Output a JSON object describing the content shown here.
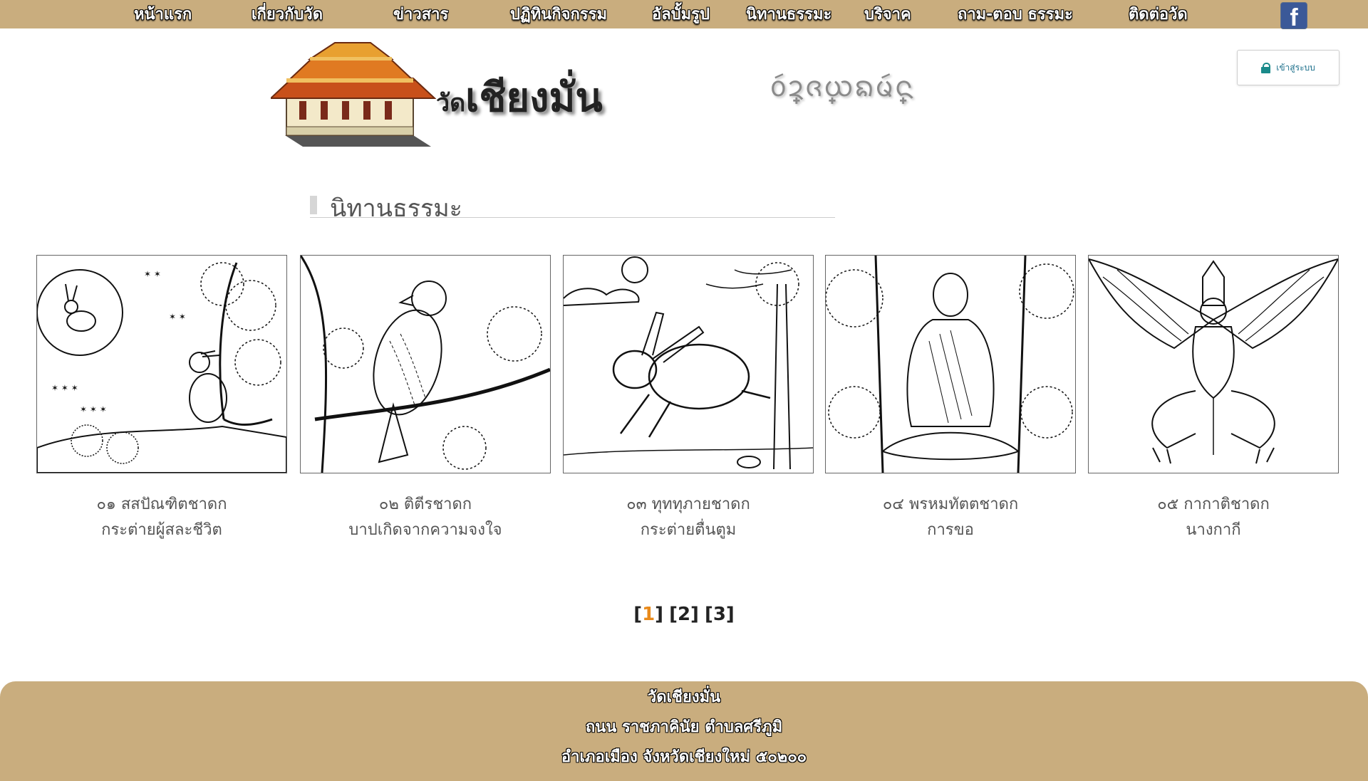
{
  "nav": {
    "items": [
      {
        "label": "หน้าแรก"
      },
      {
        "label": "เกี่ยวกับวัด"
      },
      {
        "label": "ข่าวสาร"
      },
      {
        "label": "ปฏิทินกิจกรรม"
      },
      {
        "label": "อัลบั้มรูป"
      },
      {
        "label": "นิทานธรรมะ"
      },
      {
        "label": "บริจาค"
      },
      {
        "label": "ถาม-ตอบ ธรรมะ"
      },
      {
        "label": "ติดต่อวัด"
      }
    ],
    "facebook_icon": "facebook-icon",
    "facebook_glyph": "f"
  },
  "header": {
    "brand_prefix": "วัด",
    "brand_name": "เชียงมั่น",
    "lanna_script": "ᩅᩢ᩠ᨯᨩ᩠ᨿᨦᨾᩢ᩠ᨶ",
    "login_label": "เข้าสู่ระบบ"
  },
  "section": {
    "title": "นิทานธรรมะ"
  },
  "cards": [
    {
      "title": "๐๑ สสปัณฑิตชาดก",
      "subtitle": "กระต่ายผู้สละชีวิต",
      "image": "rabbit-moon-illustration"
    },
    {
      "title": "๐๒ ติตีรชาดก",
      "subtitle": "บาปเกิดจากความจงใจ",
      "image": "bird-branch-illustration"
    },
    {
      "title": "๐๓ ทุททุภายชาดก",
      "subtitle": "กระต่ายตื่นตูม",
      "image": "running-rabbit-illustration"
    },
    {
      "title": "๐๔ พรหมทัตตชาดก",
      "subtitle": "การขอ",
      "image": "meditating-monk-illustration"
    },
    {
      "title": "๐๕ กากาติชาดก",
      "subtitle": "นางกากี",
      "image": "garuda-illustration"
    }
  ],
  "pagination": {
    "pages": [
      "1",
      "2",
      "3"
    ],
    "current": "1"
  },
  "footer": {
    "line1": "วัดเชียงมั่น",
    "line2": "ถนน ราชภาคินัย ตำบลศรีภูมิ",
    "line3": "อำเภอเมือง จังหวัดเชียงใหม่ ๕๐๒๐๐"
  },
  "colors": {
    "nav_bg": "#c9ad7e",
    "page_active": "#e98a1b",
    "login_accent": "#1a8a8a"
  }
}
